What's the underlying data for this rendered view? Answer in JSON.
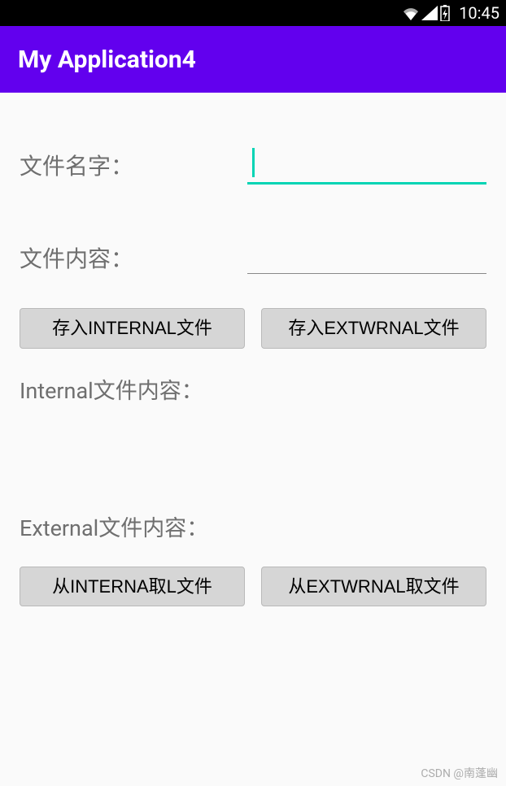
{
  "status": {
    "time": "10:45"
  },
  "app": {
    "title": "My Application4"
  },
  "fields": {
    "filename_label": "文件名字：",
    "filename_value": "",
    "content_label": "文件内容：",
    "content_value": ""
  },
  "buttons": {
    "save_internal": "存入INTERNAL文件",
    "save_external": "存入EXTWRNAL文件",
    "load_internal": "从INTERNA取L文件",
    "load_external": "从EXTWRNAL取文件"
  },
  "sections": {
    "internal_label": "Internal文件内容：",
    "external_label": "External文件内容："
  },
  "watermark": "CSDN @南蓬幽"
}
